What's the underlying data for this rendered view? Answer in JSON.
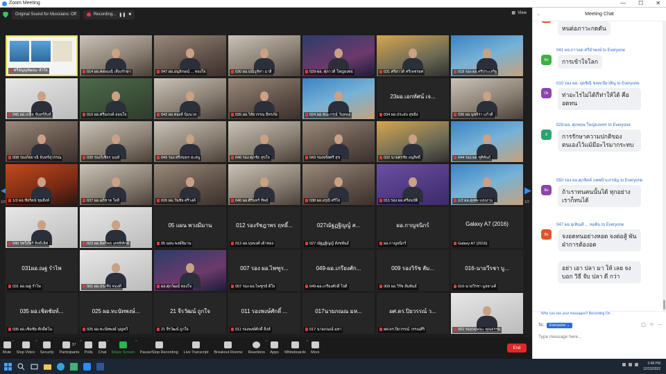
{
  "window": {
    "title": "Zoom Meeting",
    "controls": [
      "—",
      "☐",
      "✕"
    ]
  },
  "topbar": {
    "original_sound": "Original Sound for Musicians: Off",
    "recording": "Recording...",
    "view": "View"
  },
  "grid": {
    "page_left": "1/2",
    "page_right": "1/2",
    "tiles": [
      {
        "name": "ศรีอัญญพัฒนะ หัวใจ",
        "style": "share",
        "center": ""
      },
      {
        "name": "014 ผอ.ศลษมณี เลี้ยงรักษา",
        "style": "v2",
        "center": ""
      },
      {
        "name": "047 ผอ.อนุลักษณ์ ... ทองใจ",
        "style": "video",
        "center": ""
      },
      {
        "name": "030 ผอ.ปณิธูทิศา มาลี",
        "style": "v2",
        "center": ""
      },
      {
        "name": "029-ผอ. ศุภาวดี ใหญ่ยงทธ",
        "style": "v4",
        "center": ""
      },
      {
        "name": "031 ศรีสาวดี ศรีเพชรยศ",
        "style": "v5",
        "center": ""
      },
      {
        "name": "018 รอง ผอ.ศรีประเสริฐ",
        "style": "v6",
        "center": ""
      },
      {
        "name": "045 ผอ.เกล็ด จันทร์สิงห์",
        "style": "v9",
        "center": ""
      },
      {
        "name": "010 ผอ.ศรีณรงค์ อ่อนใจ",
        "style": "v3",
        "center": ""
      },
      {
        "name": "042 ผอ.ทองดี นิ่มนวล",
        "style": "v2",
        "center": ""
      },
      {
        "name": "035 ผอ.วิลัยวรรณ ยี่ทรภัย",
        "style": "video",
        "center": ""
      },
      {
        "name": "024 ผอ.ชนะกรณ์ วันทอง",
        "style": "v6",
        "center": ""
      },
      {
        "name": "034 ผอ.ประสบ สุขยิ่ง",
        "style": "dark",
        "center": "23ผอ.เอกทัศน์ เจ..."
      },
      {
        "name": "036 ผอ.นุชจิรา แก้วดี",
        "style": "v2",
        "center": ""
      },
      {
        "name": "008 รองกัลยาณี จันทร์สุวรรณ",
        "style": "video",
        "center": ""
      },
      {
        "name": "030 รองวิเชียร นนท์",
        "style": "v2",
        "center": ""
      },
      {
        "name": "049 รอง ศรีสมพร สะหนู",
        "style": "v2",
        "center": ""
      },
      {
        "name": "046 รอง ศุภชัย สุขใจ",
        "style": "v2",
        "center": ""
      },
      {
        "name": "043 รองจรัสศรี สุข",
        "style": "video",
        "center": ""
      },
      {
        "name": "032 นายศรชัย อนุสิทธิ์",
        "style": "v5",
        "center": ""
      },
      {
        "name": "044 รอง ผอ.ชุติพันธ์",
        "style": "v6",
        "center": ""
      },
      {
        "name": "1/2 ผอ.ชัยรัตน์ ชุมสิงห์",
        "style": "v7",
        "center": ""
      },
      {
        "name": "037 ผอ.อภิชาต ใจดี",
        "style": "v2",
        "center": ""
      },
      {
        "name": "026 ผอ.วันชัย ศรีวงค์",
        "style": "video",
        "center": ""
      },
      {
        "name": "040 ผอ.ศิรินทร์ ทิพย์",
        "style": "v2",
        "center": ""
      },
      {
        "name": "038 ผอ.อรุณี ศรีใส",
        "style": "video",
        "center": ""
      },
      {
        "name": "011 รอง ผอ.ศรีสมบัติ",
        "style": "v8",
        "center": ""
      },
      {
        "name": "1/2 ผอ.สุเทพ แสงงาม",
        "style": "v6",
        "center": ""
      },
      {
        "name": "040 รทวิภัทร์ อิทธิเลิศ",
        "style": "v9",
        "center": ""
      },
      {
        "name": "023 ผอ.อิทธิพล เดชพิทักษ์",
        "style": "v9",
        "center": ""
      },
      {
        "name": "05 แผน พงษ์ลิมาน",
        "style": "dark",
        "center": "05 แผน พวงมีมาน"
      },
      {
        "name": "012 ผอ.บุษบงค์ เฝ้าทอง",
        "style": "dark",
        "center": "012 รองรัชฎาพร ฤทธิ์..."
      },
      {
        "name": "027 ณัฐฏฐิญญ์ สังขพันธ์",
        "style": "dark",
        "center": "027ณัฐฏฐิญญ์ ส..."
      },
      {
        "name": "ผอ.กาญจนิกร์",
        "style": "dark",
        "center": "ผอ.กาญจนิกร์"
      },
      {
        "name": "Galaxy A7 (2016)",
        "style": "dark",
        "center": "Galaxy A7 (2016)"
      },
      {
        "name": "031 ผอ.ณฐ รำไพ",
        "style": "dark",
        "center": "031ผอ.ณฐ รำไพ"
      },
      {
        "name": "001 ผอ.ประทีป ทองดี",
        "style": "v9",
        "center": ""
      },
      {
        "name": "ผอ.ศุภวัฒน์ ทองใจ",
        "style": "v4",
        "center": ""
      },
      {
        "name": "007 รอง ผอ.ไพฑูรย์ ดีใจ",
        "style": "dark",
        "center": "007 รอง ผอ.ไพฑูร..."
      },
      {
        "name": "049-ผอ.เกรียงศักดิ์ ใจดี",
        "style": "dark",
        "center": "049-ผอ.เกรียงศัก..."
      },
      {
        "name": "009 ผอ.วิรัช สัมพันธ์",
        "style": "dark",
        "center": "009 รองวิรัช สัม..."
      },
      {
        "name": "016-นายวีรชา มูลยางค์",
        "style": "dark",
        "center": "016-นายวีรชา บู..."
      },
      {
        "name": "035 ผอ.เชิดชัย ศักดิ์ตโน",
        "style": "dark",
        "center": "035 ผอ.เชิดชัยท์..."
      },
      {
        "name": "025 ผอ.ทะนัทพงษ์ บุญทวี",
        "style": "dark",
        "center": "025 ผอ.ทะนัทพงษ์..."
      },
      {
        "name": "21 จีรวัฒน์ ถูกใจ",
        "style": "dark",
        "center": "21 จีรวัฒน์ ถูกใจ"
      },
      {
        "name": "011 รองพงษ์ศักดิ์ สิงห์",
        "style": "dark",
        "center": "011 รองพงษ์ศักดิ์ ..."
      },
      {
        "name": "017 นายภณณ์ มหา",
        "style": "dark",
        "center": "017นายภณณ มห..."
      },
      {
        "name": "ผศ.ดร.ปิยวรรณ์ วรรณศิริ",
        "style": "dark",
        "center": "ผศ.ดร.ปิยวรรณ์ ว..."
      },
      {
        "name": "002 รองกฤษณะ คุณธรรม",
        "style": "v9",
        "center": ""
      }
    ]
  },
  "toolbar": {
    "items": [
      {
        "label": "Mute",
        "icon": "microphone-icon",
        "caret": true
      },
      {
        "label": "Stop Video",
        "icon": "video-camera-icon",
        "caret": true
      },
      {
        "label": "Security",
        "icon": "shield-icon",
        "caret": false
      },
      {
        "label": "Participants",
        "icon": "participants-icon",
        "count": "37",
        "caret": true
      },
      {
        "label": "Polls",
        "icon": "polls-icon",
        "caret": false
      },
      {
        "label": "Chat",
        "icon": "chat-icon",
        "caret": true
      },
      {
        "label": "Share Screen",
        "icon": "share-screen-icon",
        "caret": true,
        "accent": "#2fb34a"
      },
      {
        "label": "Pause/Stop Recording",
        "icon": "pause-recording-icon",
        "caret": false
      },
      {
        "label": "Live Transcript",
        "icon": "cc-icon",
        "caret": false
      },
      {
        "label": "Breakout Rooms",
        "icon": "breakout-rooms-icon",
        "caret": false
      },
      {
        "label": "Reactions",
        "icon": "reactions-icon",
        "caret": true
      },
      {
        "label": "Apps",
        "icon": "apps-icon",
        "caret": false
      },
      {
        "label": "Whiteboards",
        "icon": "whiteboard-icon",
        "caret": true
      },
      {
        "label": "More",
        "icon": "more-icon",
        "caret": false
      }
    ],
    "end": "End"
  },
  "chat": {
    "title": "Meeting Chat",
    "messages": [
      {
        "meta": "",
        "text": "หนต่อภาวะกดดัน",
        "avatar": "",
        "color": "#e0542b"
      },
      {
        "meta": "041 ผอ.ภาวลด ศรีอำพงษ์ to Everyone",
        "text": "การเข้าใจโลก",
        "avatar": "Bo",
        "color": "#3cb043"
      },
      {
        "meta": "010 รอง ผอ. ฤดชิณี ชลตเขียวสิญ to Everyone",
        "text": "ท่าอะไรไม่ได้กีท่าให้ได้ คืออดทน",
        "avatar": "Ok",
        "color": "#8e44ad"
      },
      {
        "meta": "029-ผอ. ศุภหฤษ ใหญ่ยงหทร to Everyone",
        "text": "การรักษาความปกติของตนเองไว้แม้มีอะไรมากระทบ",
        "avatar": "ธ์",
        "color": "#2aa66b"
      },
      {
        "meta": "050 รอง ผอ.ศุภจิตต์ แพพนิวแกรษัฎ to Everyone",
        "text": "ถ้าเราทนคนนั้นได้ ทุกอย่างเราก็ทนได้",
        "avatar": "Bo",
        "color": "#8e44ad"
      },
      {
        "meta": "047 ผอ.อุเทิณที ... หอดิน to Everyone",
        "text": "จงอดทนอย่างหอด จงต่อสู้ พันฝ่าการต้องอด",
        "avatar": "Bo",
        "color": "#e0542b"
      },
      {
        "meta": "",
        "text": "อย่า เอา ปลา มา ให้ เลย จงบอก วิธี จับ ปลา ดี กว่า",
        "avatar": "",
        "color": ""
      }
    ],
    "notice": "Who can see your messages? Recording On",
    "to_label": "To:",
    "recipient": "Everyone ⌄",
    "placeholder": "Type message here..."
  },
  "taskbar": {
    "time": "3:48 PM",
    "date": "12/23/2022"
  }
}
